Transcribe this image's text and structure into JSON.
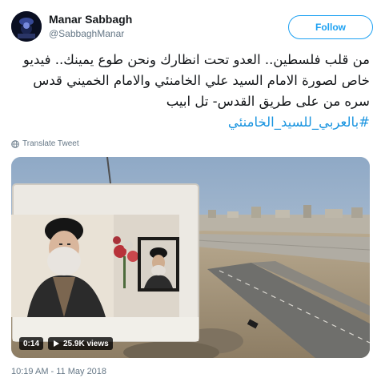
{
  "user": {
    "display_name": "Manar Sabbagh",
    "handle": "@SabbaghManar",
    "avatar_icon": "avatar-image"
  },
  "follow_button": {
    "label": "Follow",
    "color": "#1da1f2"
  },
  "tweet": {
    "lines": [
      "من قلب فلسطين.. العدو تحت انظارك ونحن طوع يمينك.. فيديو",
      "خاص لصورة الامام السيد علي الخامنئي والامام الخميني قدس",
      "سره  من على طريق القدس- تل ابيب"
    ],
    "hashtag": "#بالعربي_للسيد_الخامنئي",
    "hashtag_color": "#1b95e0"
  },
  "translate": {
    "label": "Translate Tweet",
    "icon": "globe-icon"
  },
  "media": {
    "type": "video",
    "time": "0:14",
    "views": "25.9K views",
    "views_icon": "play-icon"
  },
  "meta": {
    "timestamp": "10:19 AM - 11 May 2018"
  }
}
